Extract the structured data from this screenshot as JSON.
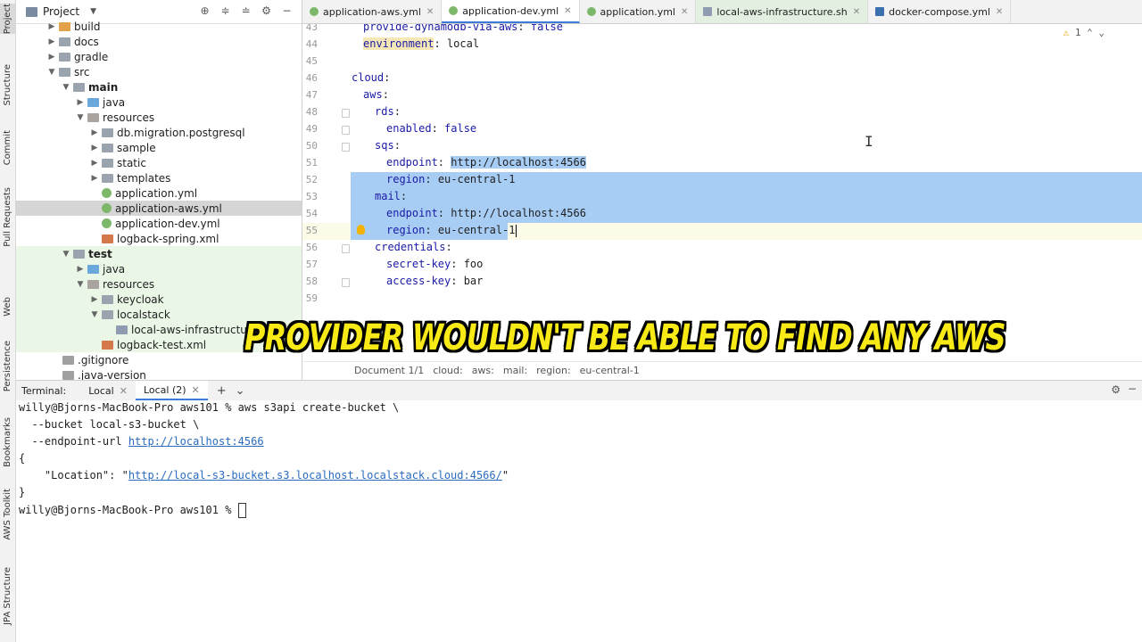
{
  "left_strip": {
    "tabs": [
      {
        "label": "Project",
        "icon": "folder-icon"
      },
      {
        "label": "Structure",
        "icon": "structure-icon"
      },
      {
        "label": "Commit",
        "icon": "commit-icon"
      },
      {
        "label": "Pull Requests",
        "icon": "pull-request-icon"
      },
      {
        "label": "Web",
        "icon": "web-icon"
      },
      {
        "label": "Persistence",
        "icon": "persistence-icon"
      },
      {
        "label": "Bookmarks",
        "icon": "bookmark-icon"
      },
      {
        "label": "AWS Toolkit",
        "icon": "aws-icon"
      },
      {
        "label": "JPA Structure",
        "icon": "jpa-icon"
      }
    ]
  },
  "project": {
    "title": "Project",
    "tree": [
      {
        "label": "build",
        "icon": "folder-orange"
      },
      {
        "label": "docs",
        "icon": "folder"
      },
      {
        "label": "gradle",
        "icon": "folder"
      },
      {
        "label": "src",
        "icon": "folder"
      },
      {
        "label": "main",
        "icon": "folder"
      },
      {
        "label": "java",
        "icon": "folder-blue"
      },
      {
        "label": "resources",
        "icon": "folder-res"
      },
      {
        "label": "db.migration.postgresql",
        "icon": "folder"
      },
      {
        "label": "sample",
        "icon": "folder"
      },
      {
        "label": "static",
        "icon": "folder"
      },
      {
        "label": "templates",
        "icon": "folder"
      },
      {
        "label": "application.yml",
        "icon": "yml"
      },
      {
        "label": "application-aws.yml",
        "icon": "yml"
      },
      {
        "label": "application-dev.yml",
        "icon": "yml"
      },
      {
        "label": "logback-spring.xml",
        "icon": "xml"
      },
      {
        "label": "test",
        "icon": "folder"
      },
      {
        "label": "java",
        "icon": "folder-blue"
      },
      {
        "label": "resources",
        "icon": "folder-res"
      },
      {
        "label": "keycloak",
        "icon": "folder"
      },
      {
        "label": "localstack",
        "icon": "folder"
      },
      {
        "label": "local-aws-infrastructure.",
        "icon": "sh"
      },
      {
        "label": "logback-test.xml",
        "icon": "xml"
      },
      {
        "label": ".gitignore",
        "icon": "git"
      },
      {
        "label": ".java-version",
        "icon": "git"
      }
    ]
  },
  "tabs": [
    {
      "label": "application-aws.yml",
      "icon": "yml"
    },
    {
      "label": "application-dev.yml",
      "icon": "yml"
    },
    {
      "label": "application.yml",
      "icon": "yml"
    },
    {
      "label": "local-aws-infrastructure.sh",
      "icon": "sh"
    },
    {
      "label": "docker-compose.yml",
      "icon": "docker"
    }
  ],
  "editor": {
    "warning_count": "1",
    "lines": [
      {
        "num": "43",
        "key": "provide-dynamodb-via-aws",
        "value": "false"
      },
      {
        "num": "44",
        "key": "environment",
        "value": "local"
      },
      {
        "num": "45",
        "key": "",
        "value": ""
      },
      {
        "num": "46",
        "key": "cloud",
        "value": ""
      },
      {
        "num": "47",
        "key": "aws",
        "value": ""
      },
      {
        "num": "48",
        "key": "rds",
        "value": ""
      },
      {
        "num": "49",
        "key": "enabled",
        "value": "false"
      },
      {
        "num": "50",
        "key": "sqs",
        "value": ""
      },
      {
        "num": "51",
        "key": "endpoint",
        "value": "http://localhost:4566"
      },
      {
        "num": "52",
        "key": "region",
        "value": "eu-central-1"
      },
      {
        "num": "53",
        "key": "mail",
        "value": ""
      },
      {
        "num": "54",
        "key": "endpoint",
        "value": "http://localhost:4566"
      },
      {
        "num": "55",
        "key": "region",
        "value": "eu-central-1"
      },
      {
        "num": "56",
        "key": "credentials",
        "value": ""
      },
      {
        "num": "57",
        "key": "secret-key",
        "value": "foo"
      },
      {
        "num": "58",
        "key": "access-key",
        "value": "bar"
      },
      {
        "num": "59",
        "key": "",
        "value": ""
      }
    ],
    "breadcrumb": [
      "Document 1/1",
      "cloud:",
      "aws:",
      "mail:",
      "region:",
      "eu-central-1"
    ]
  },
  "terminal": {
    "label": "Terminal:",
    "tabs": [
      "Local",
      "Local (2)"
    ],
    "prompt": "willy@Bjorns-MacBook-Pro aws101 % ",
    "command": "aws s3api create-bucket \\",
    "line2": "  --bucket local-s3-bucket \\",
    "line3_prefix": "  --endpoint-url ",
    "line3_link": "http://localhost:4566",
    "open_brace": "{",
    "location_key": "    \"Location\": \"",
    "location_link": "http://local-s3-bucket.s3.localhost.localstack.cloud:4566/",
    "location_suffix": "\"",
    "close_brace": "}",
    "prompt2": "willy@Bjorns-MacBook-Pro aws101 % "
  },
  "subtitle": "PROVIDER WOULDN'T BE ABLE TO FIND ANY AWS"
}
